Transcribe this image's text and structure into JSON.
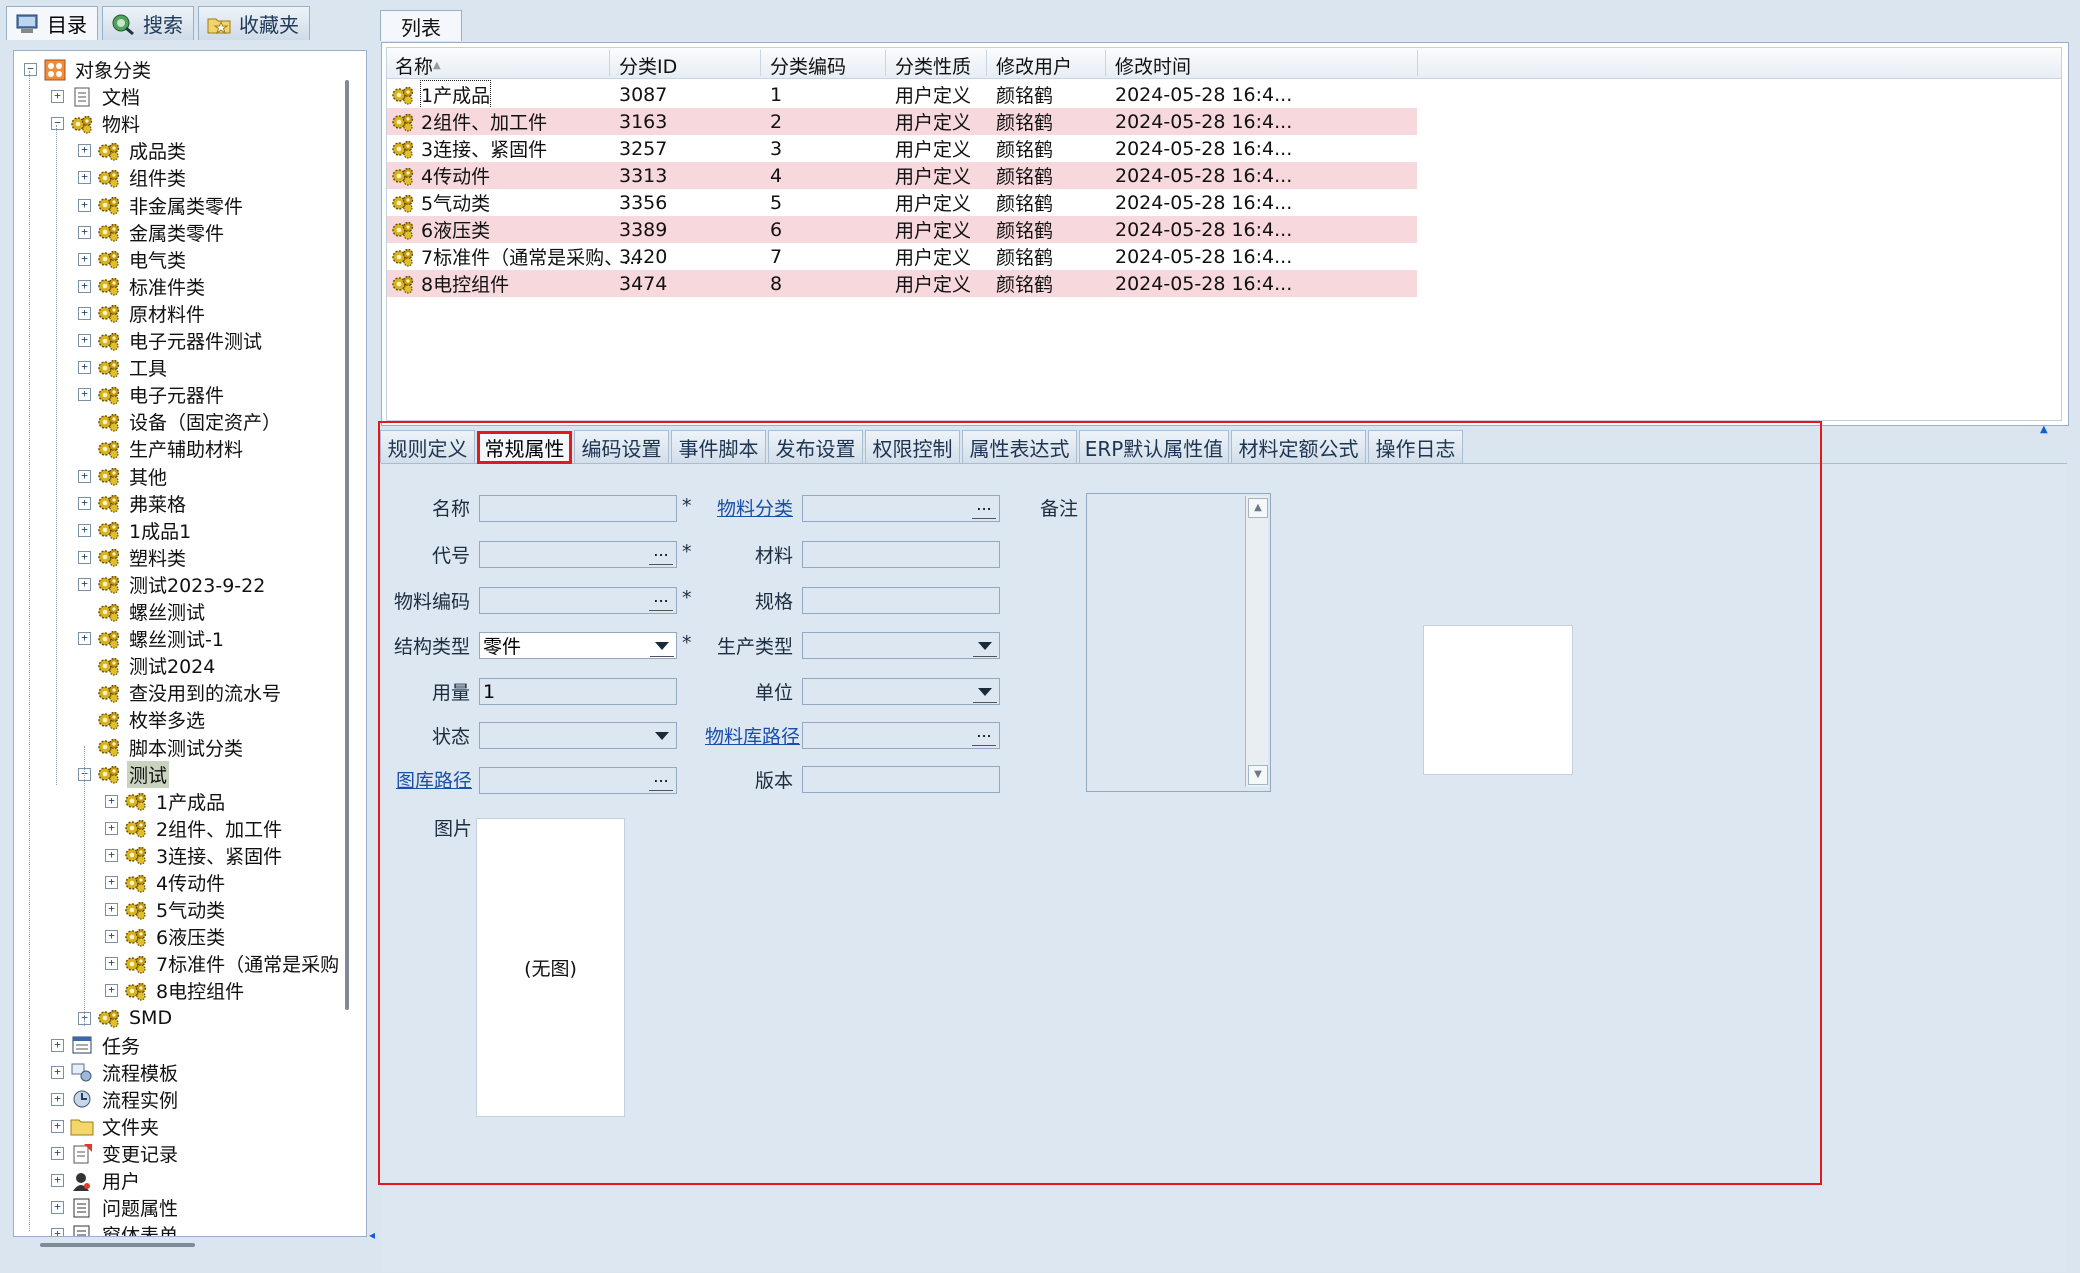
{
  "left_tabs": [
    {
      "label": "目录",
      "icon": "computer-icon",
      "active": true
    },
    {
      "label": "搜索",
      "icon": "search-globe-icon",
      "active": false
    },
    {
      "label": "收藏夹",
      "icon": "folder-star-icon",
      "active": false
    }
  ],
  "tree": {
    "root": "对象分类",
    "items": [
      "文档",
      "物料",
      "成品类",
      "组件类",
      "非金属类零件",
      "金属类零件",
      "电气类",
      "标准件类",
      "原材料件",
      "电子元器件测试",
      "工具",
      "电子元器件",
      "设备（固定资产）",
      "生产辅助材料",
      "其他",
      "弗莱格",
      "1成品1",
      "塑料类",
      "测试2023-9-22",
      "螺丝测试",
      "螺丝测试-1",
      "测试2024",
      "查没用到的流水号",
      "枚举多选",
      "脚本测试分类",
      "测试",
      "1产成品",
      "2组件、加工件",
      "3连接、紧固件",
      "4传动件",
      "5气动类",
      "6液压类",
      "7标准件（通常是采购",
      "8电控组件",
      "SMD",
      "任务",
      "流程模板",
      "流程实例",
      "文件夹",
      "变更记录",
      "用户",
      "问题属性",
      "窗体表单"
    ]
  },
  "list": {
    "tab": "列表",
    "columns": [
      "名称",
      "分类ID",
      "分类编码",
      "分类性质",
      "修改用户",
      "修改时间"
    ],
    "rows": [
      [
        "1产成品",
        "3087",
        "1",
        "用户定义",
        "颜铭鹤",
        "2024-05-28 16:4..."
      ],
      [
        "2组件、加工件",
        "3163",
        "2",
        "用户定义",
        "颜铭鹤",
        "2024-05-28 16:4..."
      ],
      [
        "3连接、紧固件",
        "3257",
        "3",
        "用户定义",
        "颜铭鹤",
        "2024-05-28 16:4..."
      ],
      [
        "4传动件",
        "3313",
        "4",
        "用户定义",
        "颜铭鹤",
        "2024-05-28 16:4..."
      ],
      [
        "5气动类",
        "3356",
        "5",
        "用户定义",
        "颜铭鹤",
        "2024-05-28 16:4..."
      ],
      [
        "6液压类",
        "3389",
        "6",
        "用户定义",
        "颜铭鹤",
        "2024-05-28 16:4..."
      ],
      [
        "7标准件（通常是采购、...",
        "3420",
        "7",
        "用户定义",
        "颜铭鹤",
        "2024-05-28 16:4..."
      ],
      [
        "8电控组件",
        "3474",
        "8",
        "用户定义",
        "颜铭鹤",
        "2024-05-28 16:4..."
      ]
    ]
  },
  "detail_tabs": [
    "规则定义",
    "常规属性",
    "编码设置",
    "事件脚本",
    "发布设置",
    "权限控制",
    "属性表达式",
    "ERP默认属性值",
    "材料定额公式",
    "操作日志"
  ],
  "form": {
    "name_label": "名称",
    "code_label": "代号",
    "matcode_label": "物料编码",
    "struct_label": "结构类型",
    "struct_value": "零件",
    "qty_label": "用量",
    "qty_value": "1",
    "state_label": "状态",
    "drawlib_label": "图库路径",
    "category_label": "物料分类",
    "material_label": "材料",
    "spec_label": "规格",
    "prodtype_label": "生产类型",
    "unit_label": "单位",
    "matlib_label": "物料库路径",
    "version_label": "版本",
    "remark_label": "备注",
    "picture_label": "图片",
    "picture_placeholder": "(无图)",
    "required_mark": "*",
    "dots": "..."
  },
  "colors": {
    "highlight_red": "#e0191d",
    "row_alt": "#f7d8dc",
    "link_blue": "#1a4fa8"
  }
}
